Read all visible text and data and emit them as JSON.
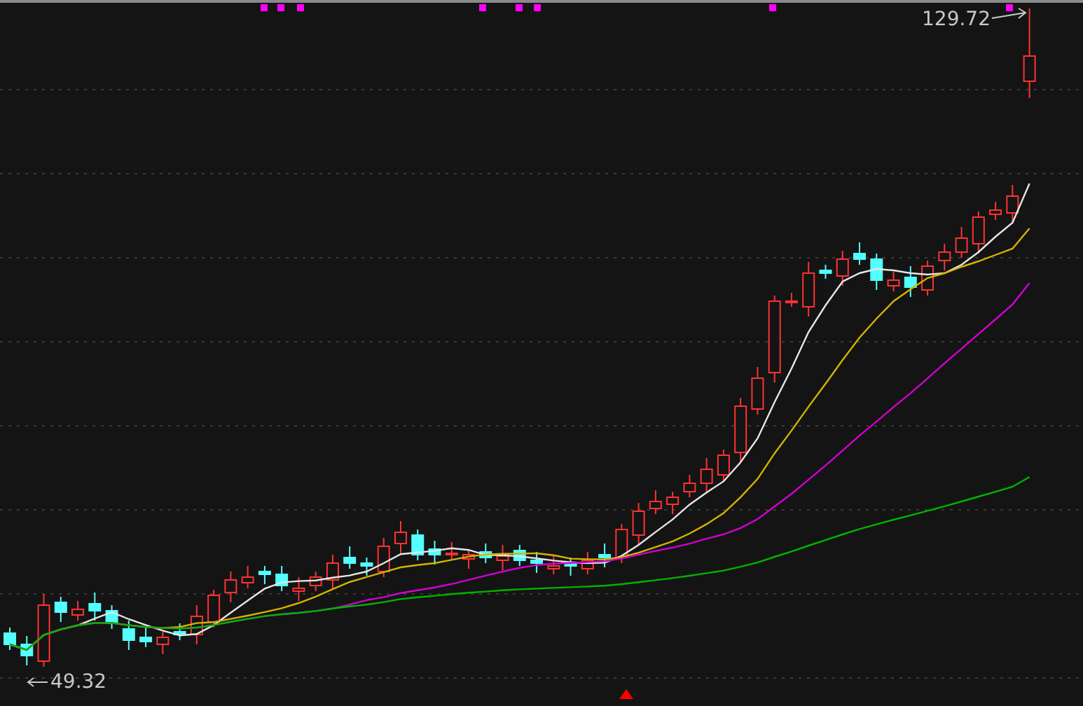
{
  "chart": {
    "high_label": "129.72",
    "low_label": "49.32"
  }
}
